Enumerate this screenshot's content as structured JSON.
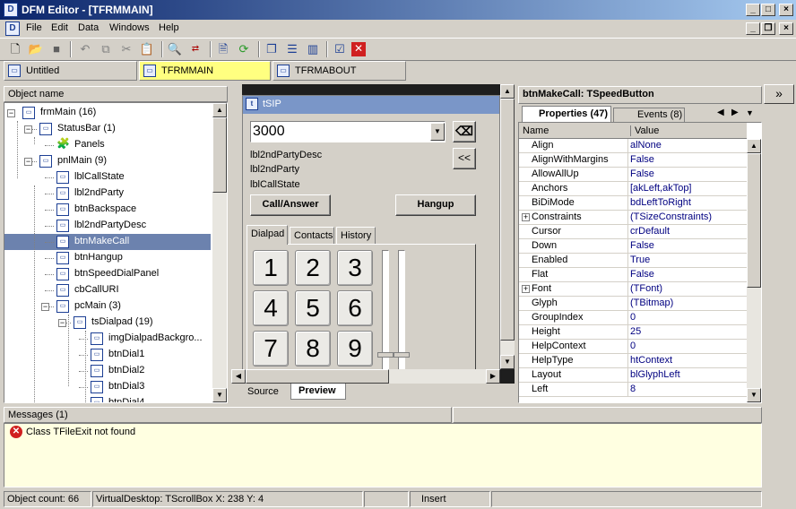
{
  "window": {
    "title": "DFM Editor - [TFRMMAIN]"
  },
  "menu": [
    "File",
    "Edit",
    "Data",
    "Windows",
    "Help"
  ],
  "doc_tabs": [
    "Untitled",
    "TFRMMAIN",
    "TFRMABOUT"
  ],
  "tree": {
    "header": "Object name",
    "nodes": [
      {
        "label": "frmMain (16)"
      },
      {
        "label": "StatusBar (1)"
      },
      {
        "label": "Panels"
      },
      {
        "label": "pnlMain (9)"
      },
      {
        "label": "lblCallState"
      },
      {
        "label": "lbl2ndParty"
      },
      {
        "label": "btnBackspace"
      },
      {
        "label": "lbl2ndPartyDesc"
      },
      {
        "label": "btnMakeCall"
      },
      {
        "label": "btnHangup"
      },
      {
        "label": "btnSpeedDialPanel"
      },
      {
        "label": "cbCallURI"
      },
      {
        "label": "pcMain (3)"
      },
      {
        "label": "tsDialpad (19)"
      },
      {
        "label": "imgDialpadBackgro..."
      },
      {
        "label": "btnDial1"
      },
      {
        "label": "btnDial2"
      },
      {
        "label": "btnDial3"
      },
      {
        "label": "btnDial4"
      }
    ]
  },
  "preview": {
    "form_title": "tSIP",
    "combo_value": "3000",
    "labels": [
      "lbl2ndPartyDesc",
      "lbl2ndParty",
      "lblCallState"
    ],
    "call_button": "Call/Answer",
    "hangup_button": "Hangup",
    "speed_button": "<<",
    "backspace_icon": "backspace-icon",
    "tabs": [
      "Dialpad",
      "Contacts",
      "History"
    ],
    "keys": [
      "1",
      "2",
      "3",
      "4",
      "5",
      "6",
      "7",
      "8",
      "9"
    ],
    "bottom_tabs": [
      "Source",
      "Preview"
    ]
  },
  "inspector": {
    "title": "btnMakeCall: TSpeedButton",
    "tabs": [
      "Properties (47)",
      "Events (8)"
    ],
    "columns": [
      "Name",
      "Value"
    ],
    "rows": [
      {
        "name": "Align",
        "value": "alNone"
      },
      {
        "name": "AlignWithMargins",
        "value": "False"
      },
      {
        "name": "AllowAllUp",
        "value": "False"
      },
      {
        "name": "Anchors",
        "value": "[akLeft,akTop]"
      },
      {
        "name": "BiDiMode",
        "value": "bdLeftToRight"
      },
      {
        "name": "Constraints",
        "value": "(TSizeConstraints)",
        "expandable": true
      },
      {
        "name": "Cursor",
        "value": "crDefault"
      },
      {
        "name": "Down",
        "value": "False"
      },
      {
        "name": "Enabled",
        "value": "True"
      },
      {
        "name": "Flat",
        "value": "False"
      },
      {
        "name": "Font",
        "value": "(TFont)",
        "expandable": true
      },
      {
        "name": "Glyph",
        "value": "(TBitmap)"
      },
      {
        "name": "GroupIndex",
        "value": "0"
      },
      {
        "name": "Height",
        "value": "25"
      },
      {
        "name": "HelpContext",
        "value": "0"
      },
      {
        "name": "HelpType",
        "value": "htContext"
      },
      {
        "name": "Layout",
        "value": "blGlyphLeft"
      },
      {
        "name": "Left",
        "value": "8"
      }
    ]
  },
  "messages": {
    "header": "Messages (1)",
    "items": [
      "Class TFileExit not found"
    ]
  },
  "statusbar": {
    "object_count": "Object count: 66",
    "info": "VirtualDesktop: TScrollBox  X: 238  Y: 4",
    "mode": "Insert"
  }
}
